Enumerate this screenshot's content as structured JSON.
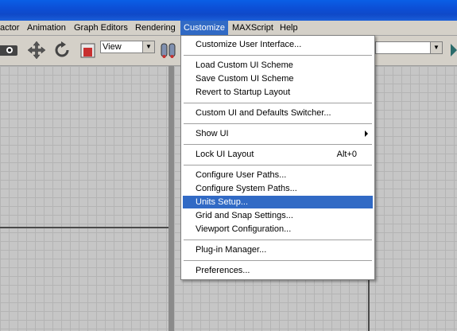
{
  "menubar": {
    "items": [
      {
        "label": "actor"
      },
      {
        "label": "Animation"
      },
      {
        "label": "Graph Editors"
      },
      {
        "label": "Rendering"
      },
      {
        "label": "Customize"
      },
      {
        "label": "MAXScript"
      },
      {
        "label": "Help"
      }
    ],
    "active_index": 4
  },
  "toolbar": {
    "reference_coord_value": "View",
    "icons": [
      "select-region-icon",
      "move-icon",
      "rotate-icon",
      "scale-icon",
      "use-pivot-icon"
    ]
  },
  "customize_menu": {
    "items": [
      {
        "label": "Customize User Interface..."
      },
      {
        "label": "Load Custom UI Scheme"
      },
      {
        "label": "Save Custom UI Scheme"
      },
      {
        "label": "Revert to Startup Layout"
      },
      {
        "label": "Custom UI and Defaults Switcher..."
      },
      {
        "label": "Show UI"
      },
      {
        "label": "Lock UI Layout",
        "shortcut": "Alt+0"
      },
      {
        "label": "Configure User Paths..."
      },
      {
        "label": "Configure System Paths..."
      },
      {
        "label": "Units Setup..."
      },
      {
        "label": "Grid and Snap Settings..."
      },
      {
        "label": "Viewport Configuration..."
      },
      {
        "label": "Plug-in Manager..."
      },
      {
        "label": "Preferences..."
      }
    ],
    "highlighted": "Units Setup..."
  },
  "colors": {
    "titlebar": "#0c4fd6",
    "menu_highlight": "#316ac5",
    "chrome": "#d4d0c8"
  }
}
